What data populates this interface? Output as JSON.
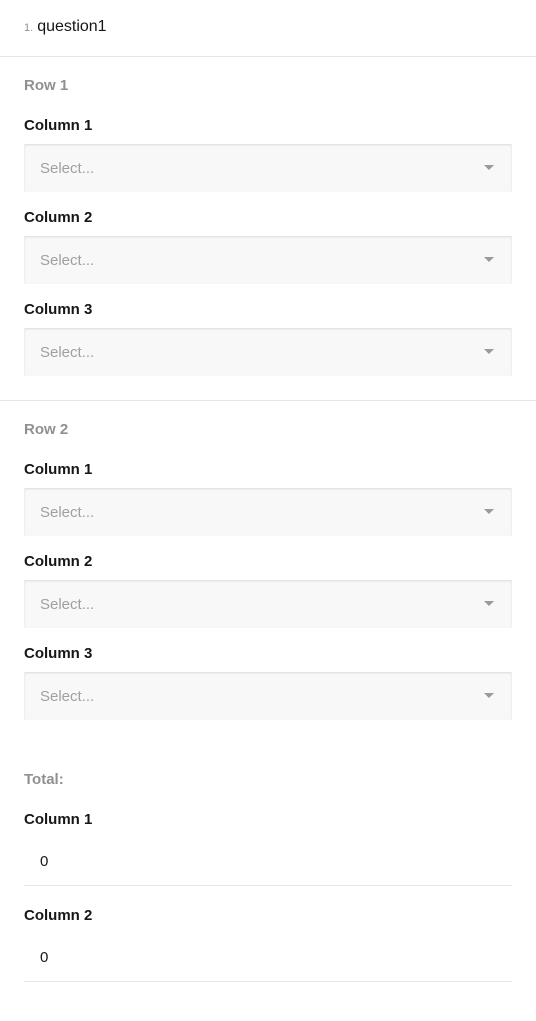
{
  "question": {
    "number": "1.",
    "title": "question1"
  },
  "rows": [
    {
      "label": "Row 1",
      "columns": [
        {
          "label": "Column 1",
          "placeholder": "Select..."
        },
        {
          "label": "Column 2",
          "placeholder": "Select..."
        },
        {
          "label": "Column 3",
          "placeholder": "Select..."
        }
      ]
    },
    {
      "label": "Row 2",
      "columns": [
        {
          "label": "Column 1",
          "placeholder": "Select..."
        },
        {
          "label": "Column 2",
          "placeholder": "Select..."
        },
        {
          "label": "Column 3",
          "placeholder": "Select..."
        }
      ]
    }
  ],
  "total": {
    "label": "Total:",
    "columns": [
      {
        "label": "Column 1",
        "value": "0"
      },
      {
        "label": "Column 2",
        "value": "0"
      }
    ]
  },
  "icons": {
    "dropdown": "chevron-down-icon"
  },
  "colors": {
    "muted_label": "#909090",
    "field_bg": "#f8f8f8",
    "divider": "#e6e6e6"
  }
}
